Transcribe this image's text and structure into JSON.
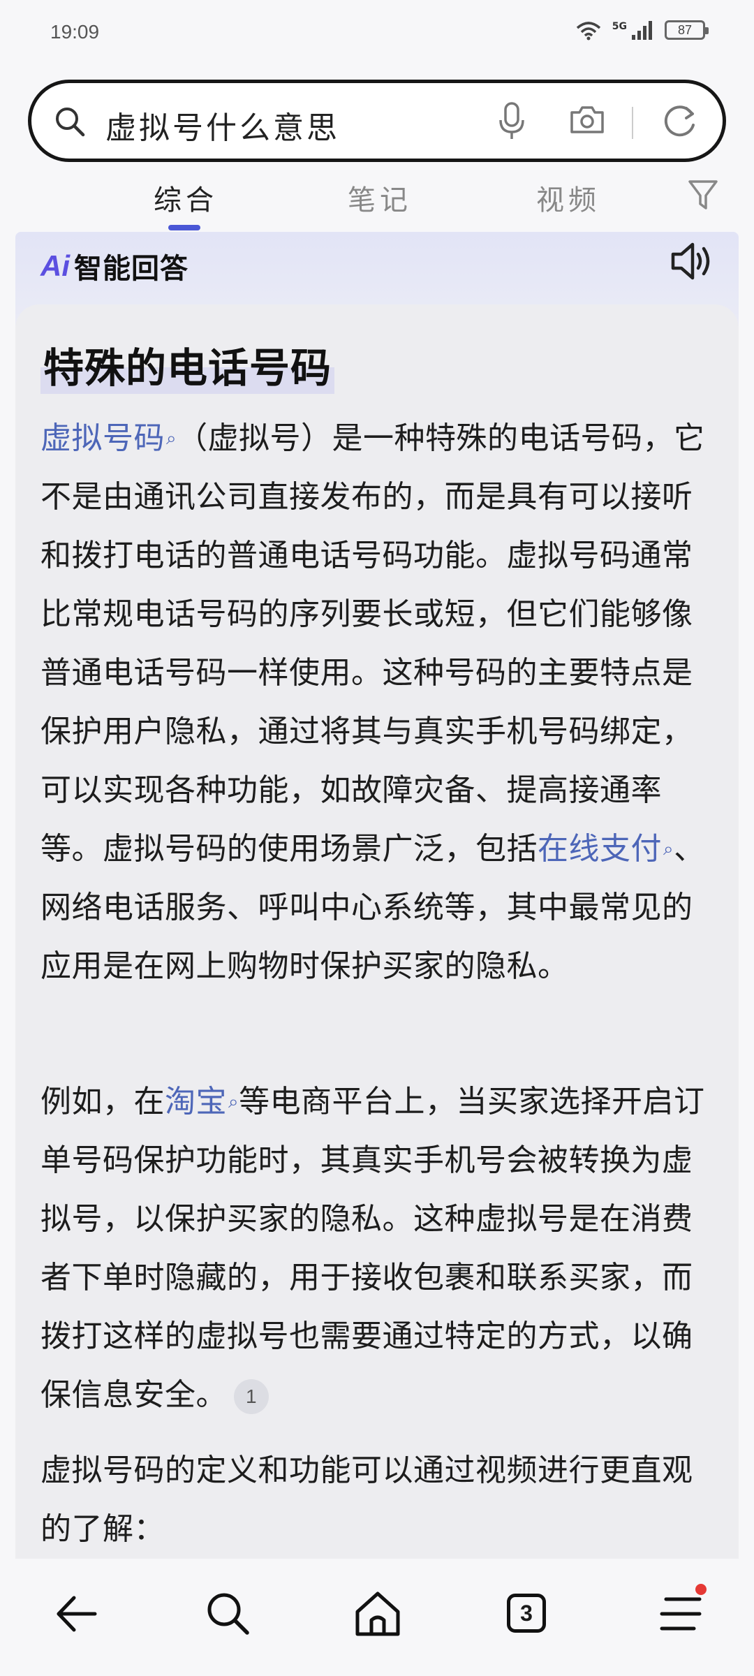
{
  "status_bar": {
    "time": "19:09",
    "network": "5G",
    "battery": "87"
  },
  "search": {
    "query": "虚拟号什么意思"
  },
  "tabs": [
    {
      "label": "综合",
      "active": true
    },
    {
      "label": "笔记",
      "active": false
    },
    {
      "label": "视频",
      "active": false
    }
  ],
  "ai": {
    "mark": "Ai",
    "title": "智能回答"
  },
  "answer": {
    "title": "特殊的电话号码",
    "p1": {
      "link1": "虚拟号码",
      "t1": "（虚拟号）是一种特殊的电话号码，它不是由通讯公司直接发布的，而是具有可以接听和拨打电话的普通电话号码功能。虚拟号码通常比常规电话号码的序列要长或短，但它们能够像普通电话号码一样使用。这种号码的主要特点是保护用户隐私，通过将其与真实手机号码绑定，可以实现各种功能，如故障灾备、提高接通率等。虚拟号码的使用场景广泛，包括",
      "link2": "在线支付",
      "t2": "、网络电话服务、呼叫中心系统等，其中最常见的应用是在网上购物时保护买家的隐私。"
    },
    "p2": {
      "t1": "例如，在",
      "link1": "淘宝",
      "t2": "等电商平台上，当买家选择开启订单号码保护功能时，其真实手机号会被转换为虚拟号，以保护买家的隐私。这种虚拟号是在消费者下单时隐藏的，用于接收包裹和联系买家，而拨打这样的虚拟号也需要通过特定的方式，以确保信息安全。",
      "citation": "1"
    },
    "p3": "虚拟号码的定义和功能可以通过视频进行更直观的了解："
  },
  "bottom_nav": {
    "tab_count": "3"
  },
  "colors": {
    "accent": "#4a57d6",
    "link": "#4d66b8",
    "notification": "#e53935"
  }
}
